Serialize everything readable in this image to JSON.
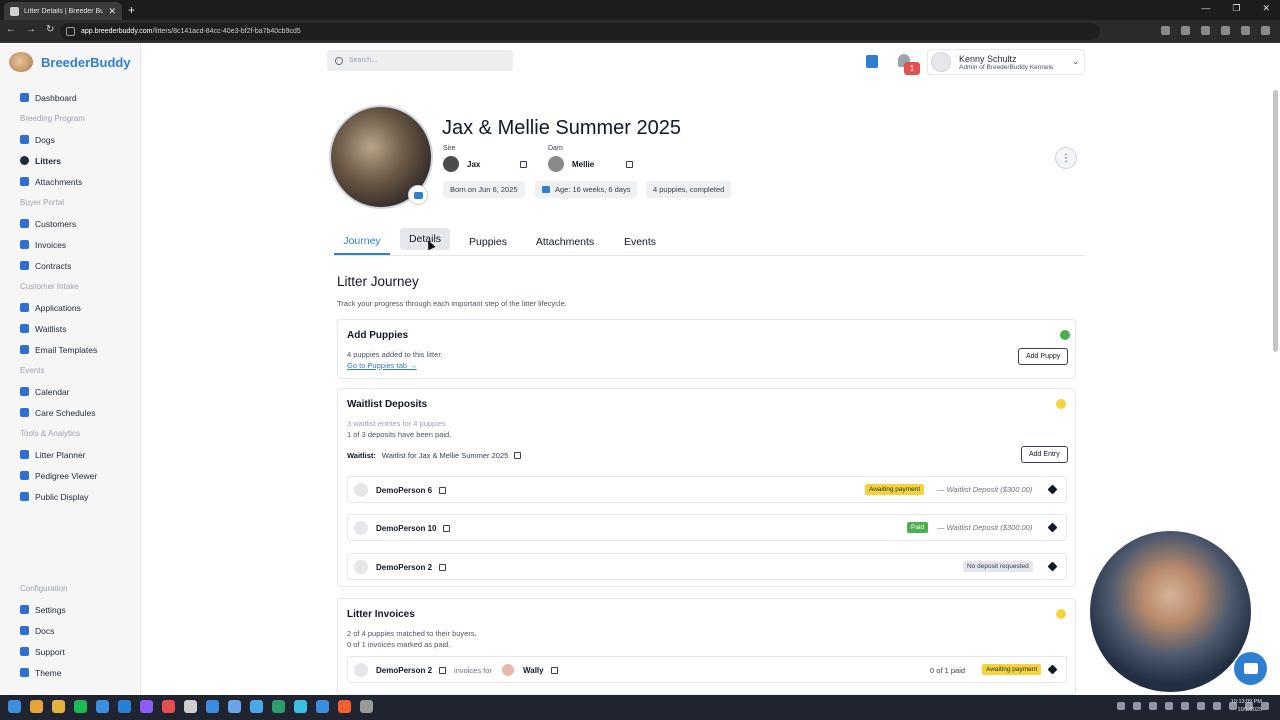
{
  "browser": {
    "tab_title": "Litter Details | Breeder Buddy",
    "url_host": "app.breederbuddy.com",
    "url_path": "/litters/8c141acd-84cc-40e3-bf2f-ba7b40cb9cd5"
  },
  "sidebar": {
    "brand": "BreederBuddy",
    "dashboard": "Dashboard",
    "sections": [
      {
        "title": "Breeding Program",
        "items": [
          "Dogs",
          "Litters",
          "Attachments"
        ]
      },
      {
        "title": "Buyer Portal",
        "items": [
          "Customers",
          "Invoices",
          "Contracts"
        ]
      },
      {
        "title": "Customer Intake",
        "items": [
          "Applications",
          "Waitlists",
          "Email Templates"
        ]
      },
      {
        "title": "Events",
        "items": [
          "Calendar",
          "Care Schedules"
        ]
      },
      {
        "title": "Tools & Analytics",
        "items": [
          "Litter Planner",
          "Pedigree Viewer",
          "Public Display"
        ]
      }
    ],
    "config_title": "Configuration",
    "config_items": [
      "Settings",
      "Docs",
      "Support",
      "Theme"
    ]
  },
  "header": {
    "search_placeholder": "Search...",
    "notification_count": "1",
    "user_name": "Kenny Schultz",
    "user_role": "Admin of BreederBuddy Kennels"
  },
  "litter": {
    "title": "Jax & Mellie Summer 2025",
    "sire_label": "Sire",
    "sire_name": "Jax",
    "dam_label": "Dam",
    "dam_name": "Mellie",
    "born": "Born on Jun 6, 2025",
    "age": "Age: 16 weeks, 6 days",
    "puppies_summary": "4 puppies, completed"
  },
  "tabs": [
    "Journey",
    "Details",
    "Puppies",
    "Attachments",
    "Events"
  ],
  "journey": {
    "title": "Litter Journey",
    "subtitle": "Track your progress through each important step of the litter lifecycle.",
    "add_puppies": {
      "title": "Add Puppies",
      "line1": "4 puppies added to this litter.",
      "link": "Go to Puppies tab →",
      "button": "Add Puppy"
    },
    "waitlist_deposits": {
      "title": "Waitlist Deposits",
      "line1": "3 waitlist entries for 4 puppies",
      "line2": "1 of 3 deposits have been paid.",
      "waitlist_label": "Waitlist:",
      "waitlist_name": "Waitlist for Jax & Mellie Summer 2025",
      "button": "Add Entry",
      "entries": [
        {
          "name": "DemoPerson 6",
          "status": "Awaiting payment",
          "deposit": "— Waitlist Deposit ($300.00)"
        },
        {
          "name": "DemoPerson 10",
          "status": "Paid",
          "deposit": "— Waitlist Deposit ($300.00)"
        },
        {
          "name": "DemoPerson 2",
          "status": "No deposit requested",
          "deposit": ""
        }
      ]
    },
    "litter_invoices": {
      "title": "Litter Invoices",
      "line1": "2 of 4 puppies matched to their buyers.",
      "line2": "0 of 1 invoices marked as paid.",
      "entry": {
        "name": "DemoPerson 2",
        "invoices_for": "invoices for",
        "puppy": "Wally",
        "paid": "0 of 1 paid",
        "status": "Awaiting payment"
      }
    }
  },
  "taskbar": {
    "time": "10:13:09 PM",
    "date": "10/1/2025"
  }
}
